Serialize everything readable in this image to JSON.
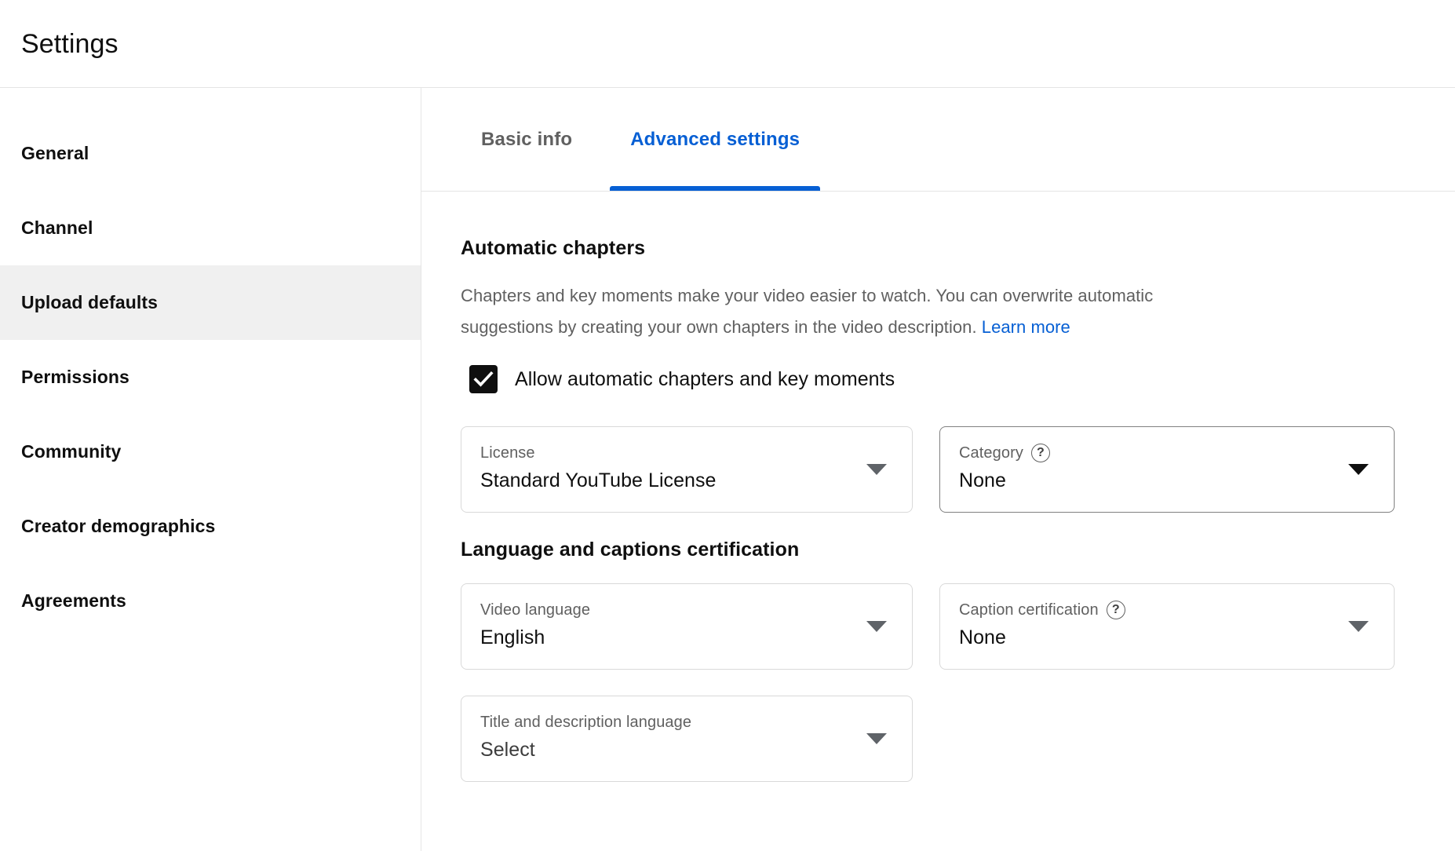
{
  "header": {
    "title": "Settings"
  },
  "sidebar": {
    "items": [
      {
        "label": "General",
        "active": false
      },
      {
        "label": "Channel",
        "active": false
      },
      {
        "label": "Upload defaults",
        "active": true
      },
      {
        "label": "Permissions",
        "active": false
      },
      {
        "label": "Community",
        "active": false
      },
      {
        "label": "Creator demographics",
        "active": false
      },
      {
        "label": "Agreements",
        "active": false
      }
    ]
  },
  "tabs": [
    {
      "label": "Basic info",
      "active": false
    },
    {
      "label": "Advanced settings",
      "active": true
    }
  ],
  "automatic_chapters": {
    "title": "Automatic chapters",
    "description": "Chapters and key moments make your video easier to watch. You can overwrite automatic suggestions by creating your own chapters in the video description.",
    "learn_more_label": "Learn more",
    "checkbox": {
      "label": "Allow automatic chapters and key moments",
      "checked": true,
      "icon": "checkmark-icon"
    }
  },
  "license_field": {
    "label": "License",
    "value": "Standard YouTube License",
    "caret_icon": "chevron-down-icon"
  },
  "category_field": {
    "label": "Category",
    "value": "None",
    "help_icon": "help-question-icon",
    "help_glyph": "?",
    "caret_icon": "chevron-down-icon"
  },
  "language_section": {
    "title": "Language and captions certification"
  },
  "video_language_field": {
    "label": "Video language",
    "value": "English",
    "caret_icon": "chevron-down-icon"
  },
  "caption_certification_field": {
    "label": "Caption certification",
    "value": "None",
    "help_icon": "help-question-icon",
    "help_glyph": "?",
    "caret_icon": "chevron-down-icon"
  },
  "title_description_language_field": {
    "label": "Title and description language",
    "value": "Select",
    "caret_icon": "chevron-down-icon"
  },
  "colors": {
    "accent": "#065fd4",
    "text_primary": "#0f0f0f",
    "text_secondary": "#606060",
    "active_row_bg": "#f0f0f0",
    "border": "#e5e5e5"
  }
}
